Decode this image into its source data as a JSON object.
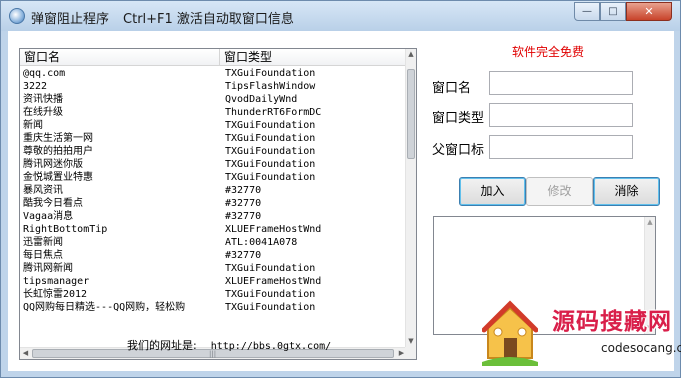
{
  "window": {
    "title": "弹窗阻止程序",
    "title_hint": "Ctrl+F1 激活自动取窗口信息",
    "buttons": {
      "minimize": "—",
      "maximize": "□",
      "close": "✕"
    }
  },
  "list": {
    "columns": [
      "窗口名",
      "窗口类型"
    ],
    "rows": [
      {
        "name": "@qq.com",
        "type": "TXGuiFoundation"
      },
      {
        "name": "3222",
        "type": "TipsFlashWindow"
      },
      {
        "name": "资讯快播",
        "type": "QvodDailyWnd"
      },
      {
        "name": "在线升级",
        "type": "ThunderRT6FormDC"
      },
      {
        "name": "新闻",
        "type": "TXGuiFoundation"
      },
      {
        "name": "重庆生活第一网",
        "type": "TXGuiFoundation"
      },
      {
        "name": "尊敬的拍拍用户",
        "type": "TXGuiFoundation"
      },
      {
        "name": "腾讯网迷你版",
        "type": "TXGuiFoundation"
      },
      {
        "name": "金悦城置业特惠",
        "type": "TXGuiFoundation"
      },
      {
        "name": "暴风资讯",
        "type": "#32770"
      },
      {
        "name": "酷我今日看点",
        "type": "#32770"
      },
      {
        "name": "Vagaa消息",
        "type": "#32770"
      },
      {
        "name": "RightBottomTip",
        "type": "XLUEFrameHostWnd"
      },
      {
        "name": "迅雷新闻",
        "type": "ATL:0041A078"
      },
      {
        "name": "每日焦点",
        "type": "#32770"
      },
      {
        "name": "腾讯网新闻",
        "type": "TXGuiFoundation"
      },
      {
        "name": "tipsmanager",
        "type": "XLUEFrameHostWnd"
      },
      {
        "name": "长虹惊雷2012",
        "type": "TXGuiFoundation"
      },
      {
        "name": "QQ网购每日精选---QQ网购，轻松购",
        "type": "TXGuiFoundation"
      }
    ]
  },
  "site": {
    "label": "我们的网址是:",
    "url": "http://bbs.0gtx.com/"
  },
  "panel": {
    "free_text": "软件完全免费",
    "fields": {
      "name_label": "窗口名",
      "type_label": "窗口类型",
      "parent_label": "父窗口标",
      "name_value": "",
      "type_value": "",
      "parent_value": ""
    },
    "buttons": {
      "add": "加入",
      "edit": "修改",
      "clear": "消除"
    },
    "log_text": ""
  },
  "watermark": {
    "brand": "源码搜藏网",
    "url": "codesocang.com"
  },
  "colors": {
    "free_text": "#e00000",
    "watermark_brand": "#d91f4a"
  }
}
